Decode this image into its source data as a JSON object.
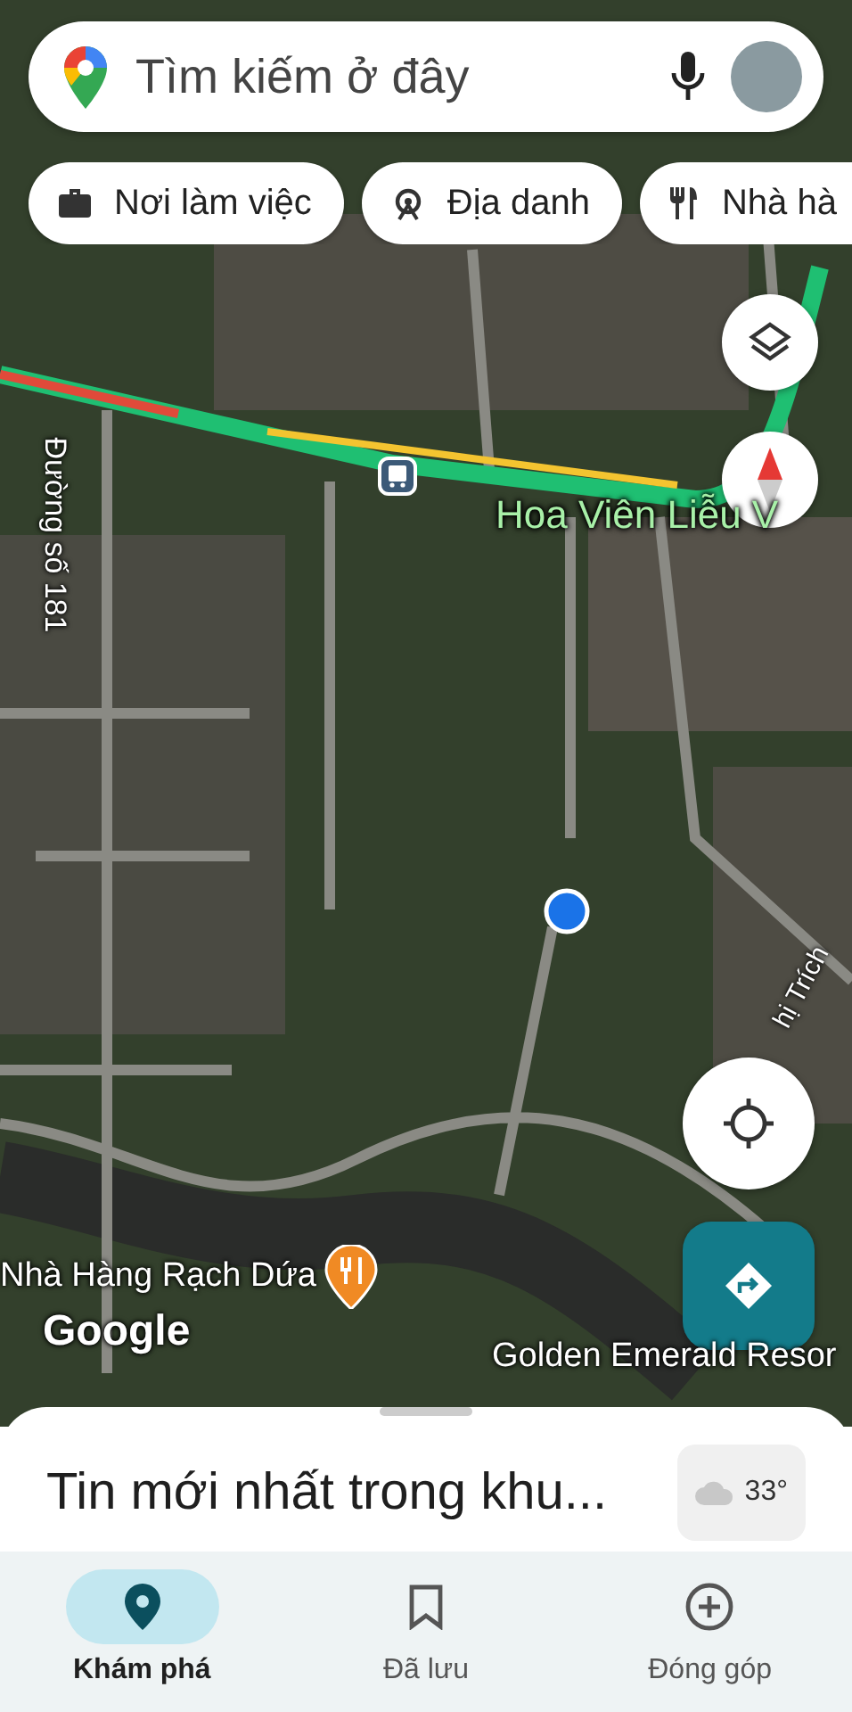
{
  "search": {
    "placeholder": "Tìm kiếm ở đây"
  },
  "chips": [
    {
      "label": "Nơi làm việc",
      "kind": "work"
    },
    {
      "label": "Địa danh",
      "kind": "landmark"
    },
    {
      "label": "Nhà hà",
      "kind": "food"
    }
  ],
  "map": {
    "labels": [
      {
        "text": "Hoa Viên Liễu V",
        "kind": "place"
      },
      {
        "text": "Đường số 181",
        "kind": "road"
      },
      {
        "text": "hị Trích",
        "kind": "road2"
      },
      {
        "text": "Nhà Hàng Rạch Dứa",
        "kind": "poi"
      },
      {
        "text": "Google",
        "kind": "logo"
      },
      {
        "text": "Golden Emerald Resor",
        "kind": "place2"
      }
    ]
  },
  "sheet": {
    "title": "Tin mới nhất trong khu...",
    "weather": "33°"
  },
  "nav": [
    {
      "label": "Khám phá",
      "kind": "explore",
      "selected": true
    },
    {
      "label": "Đã lưu",
      "kind": "saved",
      "selected": false
    },
    {
      "label": "Đóng góp",
      "kind": "contribute",
      "selected": false
    }
  ]
}
